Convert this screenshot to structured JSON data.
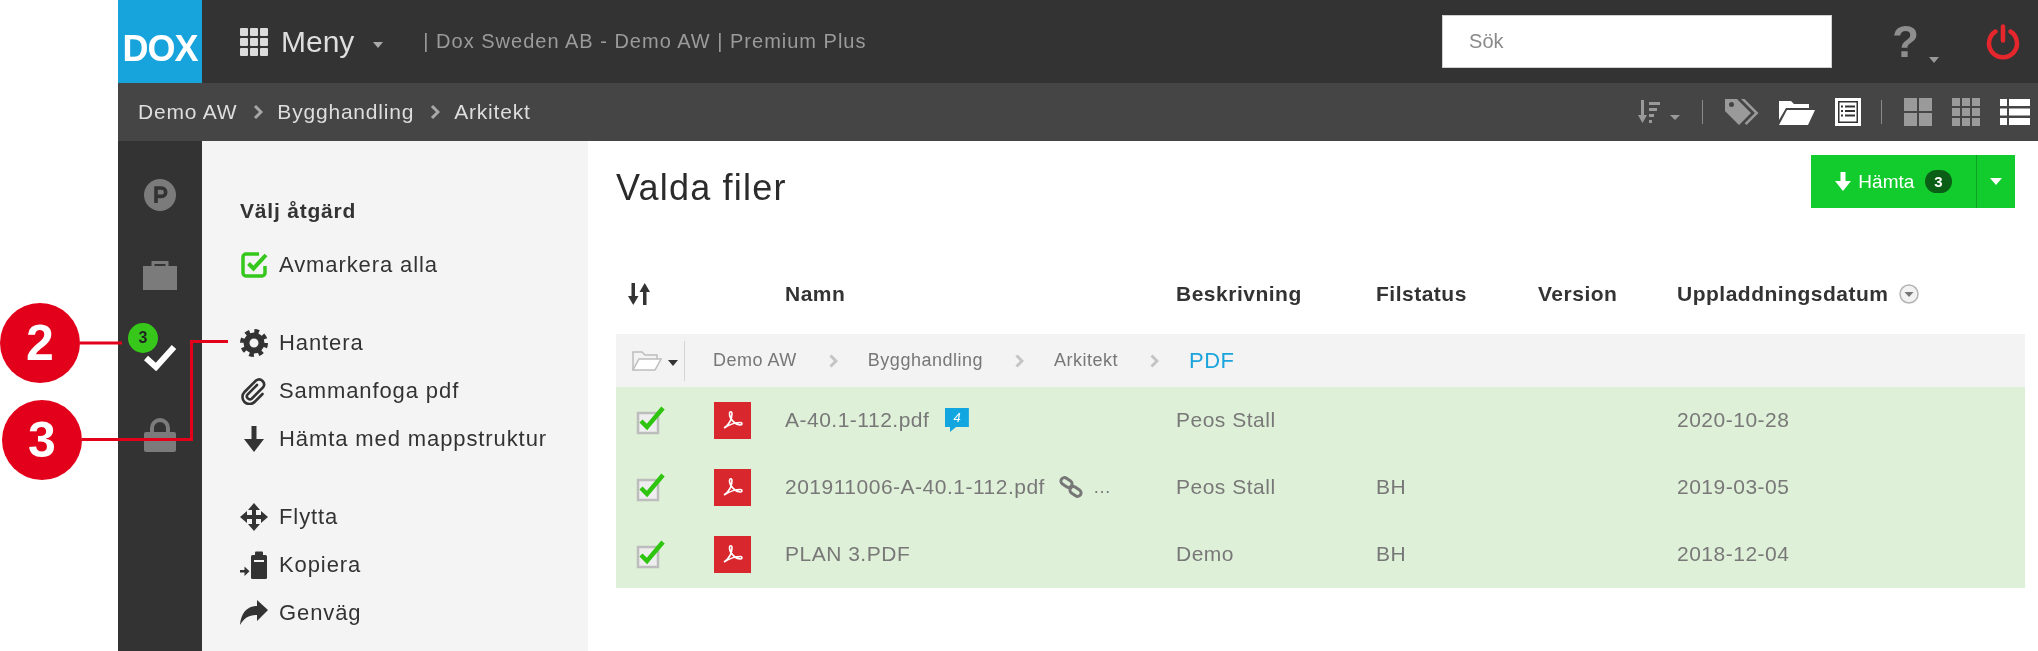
{
  "top_bar": {
    "logo": "DOX",
    "menu_label": "Meny",
    "account": "| Dox Sweden AB - Demo AW | Premium Plus",
    "search": {
      "placeholder": "Sök"
    },
    "help_label": "?"
  },
  "breadcrumb": [
    "Demo AW",
    "Bygghandling",
    "Arkitekt"
  ],
  "toolbar": {
    "toggles": [
      {
        "on": false
      },
      {
        "on": true
      },
      {
        "on": true
      }
    ],
    "views": [
      {
        "selected": false
      },
      {
        "selected": false
      },
      {
        "selected": true
      }
    ]
  },
  "sidebar": {
    "items": [
      {
        "selected": false
      },
      {
        "selected": false
      },
      {
        "selected": true,
        "badge": "3"
      },
      {
        "selected": false
      }
    ]
  },
  "action_panel": {
    "title": "Välj åtgärd",
    "groups": [
      [
        "Avmarkera alla"
      ],
      [
        "Hantera",
        "Sammanfoga pdf",
        "Hämta med mappstruktur"
      ],
      [
        "Flytta",
        "Kopiera",
        "Genväg"
      ]
    ]
  },
  "main": {
    "title": "Valda filer",
    "download_button": {
      "label": "Hämta",
      "count": "3"
    },
    "table": {
      "columns": [
        {
          "label": "Namn",
          "sorted": false
        },
        {
          "label": "Beskrivning",
          "sorted": false
        },
        {
          "label": "Filstatus",
          "sorted": false
        },
        {
          "label": "Version",
          "sorted": false
        },
        {
          "label": "Uppladdningsdatum",
          "sorted": true
        }
      ],
      "path": [
        {
          "label": "Demo AW",
          "selected": false
        },
        {
          "label": "Bygghandling",
          "selected": false
        },
        {
          "label": "Arkitekt",
          "selected": false
        },
        {
          "label": "PDF",
          "selected": true
        }
      ],
      "rows": [
        {
          "checked": true,
          "selected": true,
          "name": "A-40.1-112.pdf",
          "comments": "4",
          "linked": false,
          "description": "Peos Stall",
          "date": "2020-10-28"
        },
        {
          "checked": true,
          "selected": true,
          "name": "201911006-A-40.1-112.pdf",
          "linked": true,
          "more": "…",
          "description": "Peos Stall",
          "status": "BH",
          "date": "2019-03-05"
        },
        {
          "checked": true,
          "selected": true,
          "name": "PLAN 3.PDF",
          "linked": false,
          "description": "Demo",
          "status": "BH",
          "date": "2018-12-04"
        }
      ]
    }
  },
  "callouts": [
    {
      "number": "2"
    },
    {
      "number": "3"
    }
  ]
}
